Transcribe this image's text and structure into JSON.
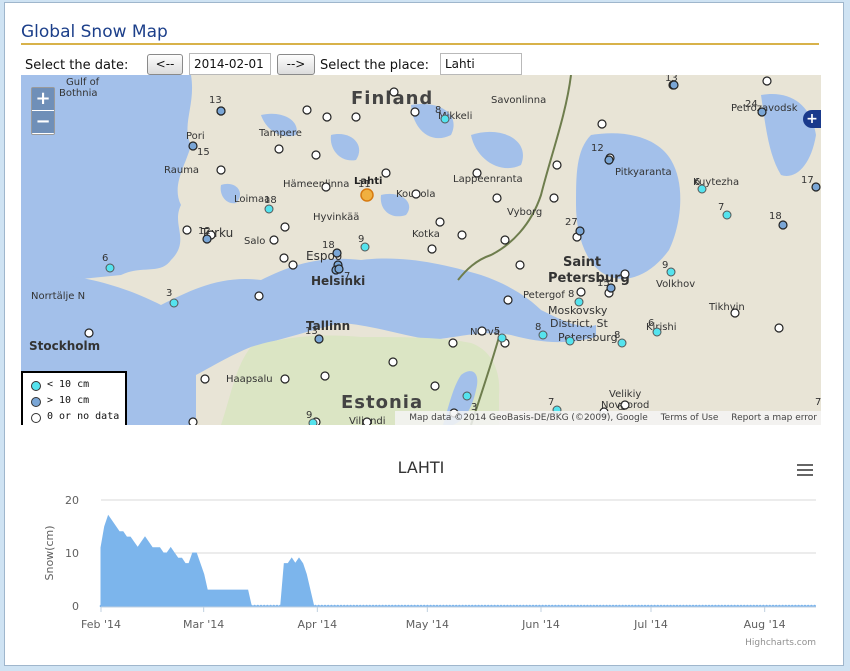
{
  "page": {
    "title": "Global Snow Map"
  },
  "controls": {
    "date_label": "Select the date:",
    "prev_label": "<--",
    "date_value": "2014-02-01",
    "next_label": "-->",
    "place_label": "Select the place:",
    "place_value": "Lahti"
  },
  "map": {
    "zoom_in": "+",
    "zoom_out": "−",
    "side_button": "+",
    "countries": [
      "Finland",
      "Estonia"
    ],
    "places": [
      "Gulf of",
      "Bothnia",
      "Pori",
      "Rauma",
      "Tampere",
      "Hämeenlinna",
      "Lahti",
      "Kouvola",
      "Lappeenranta",
      "Savonlinna",
      "Mikkeli",
      "Loimaa",
      "Hyvinkää",
      "Turku",
      "Salo",
      "Kotka",
      "Vyborg",
      "Espoo",
      "Helsinki",
      "Tallinn",
      "Stockholm",
      "Norrtälje N",
      "Haapsalu",
      "Viljandi",
      "Narva",
      "Saint Petersburg",
      "Petergof",
      "Moskovsky District, St Petersburg",
      "Kirishi",
      "Volkhov",
      "Tikhvin",
      "Pitkyaranta",
      "Petrozavodsk",
      "Kuytezha",
      "Velikiy Novgorod"
    ],
    "legend": [
      {
        "label": "< 10 cm",
        "color": "#55e3ee"
      },
      {
        "label": "> 10 cm",
        "color": "#7aa6d6"
      },
      {
        "label": "0 or no data",
        "color": "#ffffff"
      }
    ],
    "attribution": {
      "data": "Map data ©2014 GeoBasis-DE/BKG (©2009), Google",
      "terms": "Terms of Use",
      "report": "Report a map error"
    },
    "station_numbers": [
      "13",
      "15",
      "8",
      "12",
      "24",
      "13",
      "6",
      "17",
      "7",
      "18",
      "12",
      "11",
      "18",
      "9",
      "27",
      "18",
      "6",
      "3",
      "13",
      "9",
      "15",
      "8",
      "5",
      "8",
      "8",
      "6",
      "7",
      "9",
      "3",
      "7",
      "6",
      "7"
    ]
  },
  "chart_data": {
    "type": "area",
    "title": "LAHTI",
    "xlabel": "",
    "ylabel": "Snow(cm)",
    "ylim": [
      0,
      20
    ],
    "y_ticks": [
      "0",
      "10",
      "20"
    ],
    "x_ticks": [
      "Feb '14",
      "Mar '14",
      "Apr '14",
      "May '14",
      "Jun '14",
      "Jul '14",
      "Aug '14"
    ],
    "grid": true,
    "color": "#7cb5ec",
    "series": [
      {
        "x": [
          "2014-02-01",
          "2014-02-02",
          "2014-02-03",
          "2014-02-04",
          "2014-02-05",
          "2014-02-06",
          "2014-02-07",
          "2014-02-08",
          "2014-02-09",
          "2014-02-10",
          "2014-02-11",
          "2014-02-12",
          "2014-02-13",
          "2014-02-14",
          "2014-02-15",
          "2014-02-16",
          "2014-02-17",
          "2014-02-18",
          "2014-02-19",
          "2014-02-20",
          "2014-02-21",
          "2014-02-22",
          "2014-02-23",
          "2014-02-24",
          "2014-02-25",
          "2014-02-26",
          "2014-02-27",
          "2014-02-28",
          "2014-03-01",
          "2014-03-02",
          "2014-03-03",
          "2014-03-04",
          "2014-03-05",
          "2014-03-06",
          "2014-03-07",
          "2014-03-08",
          "2014-03-09",
          "2014-03-10",
          "2014-03-11",
          "2014-03-12",
          "2014-03-13",
          "2014-03-14",
          "2014-03-15",
          "2014-03-16",
          "2014-03-17",
          "2014-03-18",
          "2014-03-19",
          "2014-03-20",
          "2014-03-21",
          "2014-03-22",
          "2014-03-23",
          "2014-03-24",
          "2014-03-25",
          "2014-03-26",
          "2014-03-27",
          "2014-03-28",
          "2014-03-29",
          "2014-03-30",
          "2014-03-31",
          "2014-08-15"
        ],
        "values": [
          11,
          15,
          17,
          16,
          15,
          14,
          14,
          13,
          13,
          12,
          11,
          12,
          13,
          12,
          11,
          11,
          11,
          10,
          10,
          11,
          10,
          9,
          9,
          8,
          8,
          10,
          10,
          8,
          6,
          3,
          3,
          3,
          3,
          3,
          3,
          3,
          3,
          3,
          3,
          3,
          3,
          0,
          0,
          0,
          0,
          0,
          0,
          0,
          0,
          0,
          8,
          8,
          9,
          8,
          9,
          8,
          6,
          3,
          0,
          0
        ]
      }
    ]
  }
}
